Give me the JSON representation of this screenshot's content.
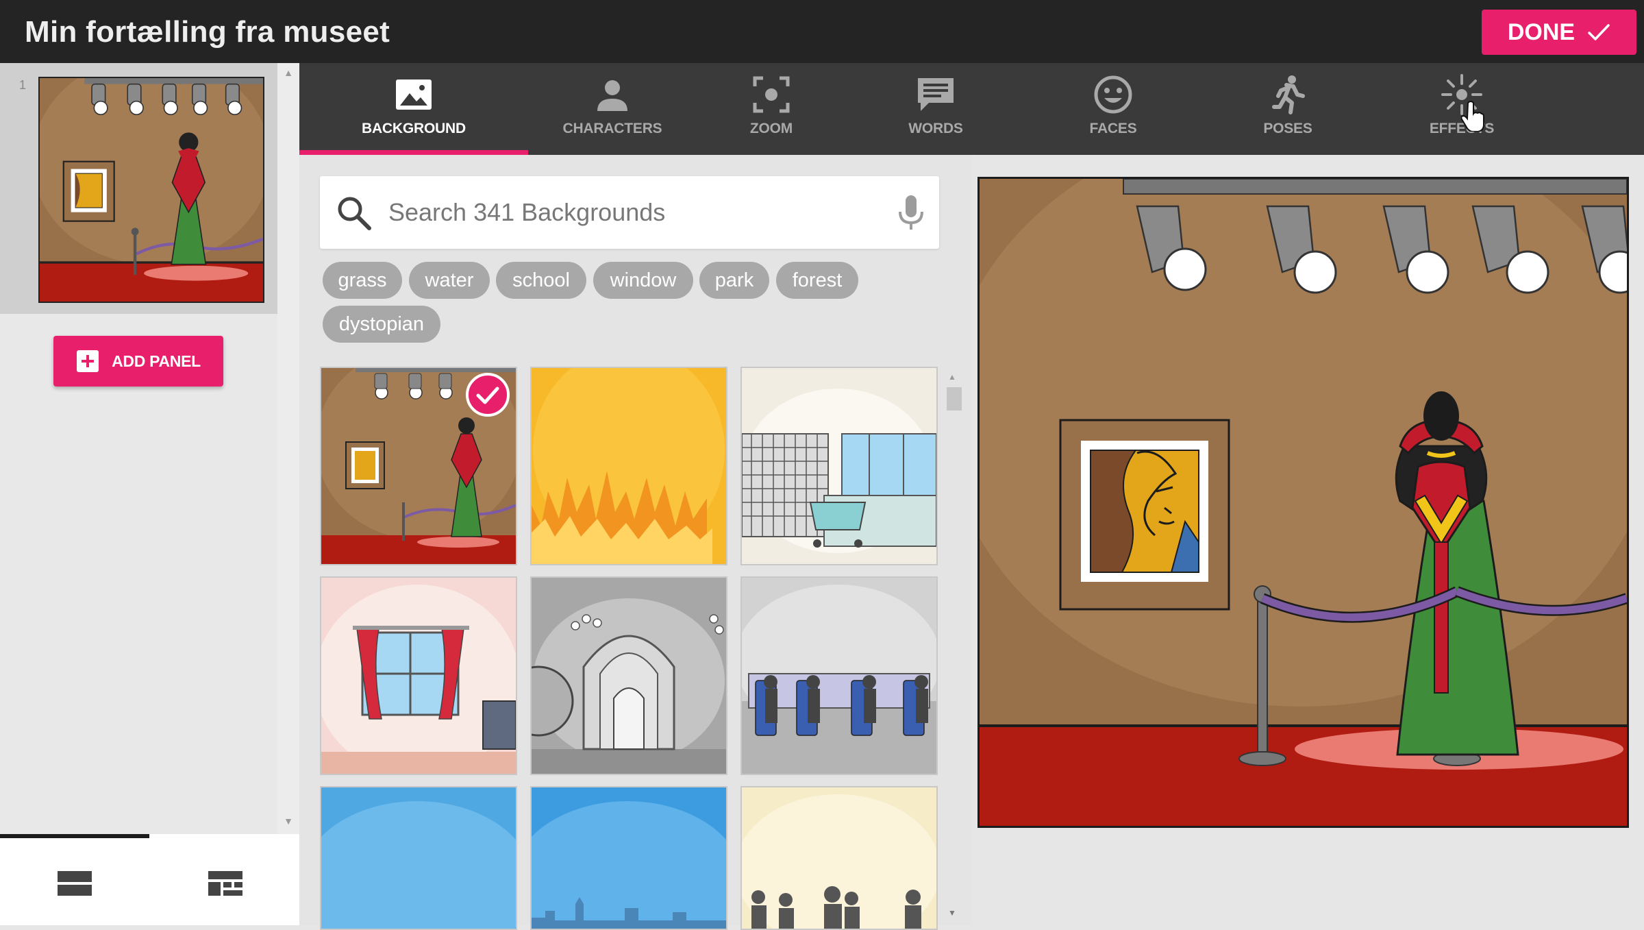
{
  "app": {
    "title": "Min fortælling fra museet",
    "done_label": "DONE"
  },
  "panels": [
    {
      "number": "1"
    }
  ],
  "add_panel_label": "ADD PANEL",
  "tabs": [
    {
      "label": "BACKGROUND",
      "icon": "image-icon",
      "active": true
    },
    {
      "label": "CHARACTERS",
      "icon": "person-icon",
      "active": false
    },
    {
      "label": "ZOOM",
      "icon": "zoom-focus-icon",
      "active": false
    },
    {
      "label": "WORDS",
      "icon": "speech-bubble-icon",
      "active": false
    },
    {
      "label": "FACES",
      "icon": "smiley-face-icon",
      "active": false
    },
    {
      "label": "POSES",
      "icon": "running-person-icon",
      "active": false
    },
    {
      "label": "EFFECTS",
      "icon": "sparkle-effects-icon",
      "active": false
    }
  ],
  "search": {
    "placeholder": "Search 341 Backgrounds",
    "value": ""
  },
  "tags": [
    "grass",
    "water",
    "school",
    "window",
    "park",
    "forest",
    "dystopian"
  ],
  "backgrounds": [
    {
      "name": "museum",
      "selected": true
    },
    {
      "name": "fire",
      "selected": false
    },
    {
      "name": "store-checkout",
      "selected": false
    },
    {
      "name": "window-curtains",
      "selected": false
    },
    {
      "name": "throne-room",
      "selected": false
    },
    {
      "name": "train-seats",
      "selected": false
    },
    {
      "name": "sky-plain",
      "selected": false
    },
    {
      "name": "sky-city",
      "selected": false
    },
    {
      "name": "audience",
      "selected": false
    }
  ],
  "colors": {
    "accent": "#e8206b",
    "toolbar": "#3a3a3a",
    "titlebar": "#242424",
    "museum_wall": "#98714a",
    "museum_floor": "#b01c12"
  }
}
